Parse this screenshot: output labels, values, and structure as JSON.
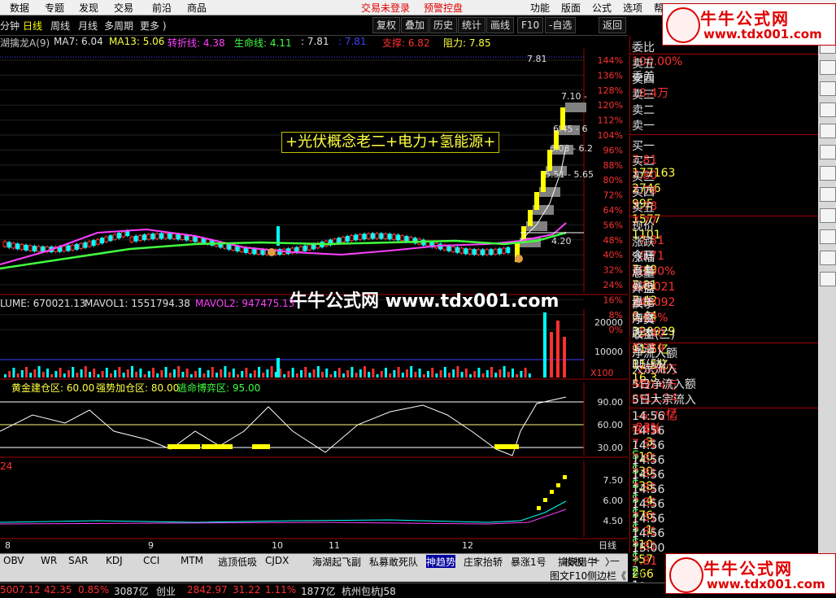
{
  "menu": {
    "items": [
      "数据",
      "专题",
      "发现",
      "交易",
      "前沿",
      "商品"
    ],
    "trade_login": "交易未登录",
    "warning": "预警控盘",
    "right_items": [
      "功能",
      "版面",
      "公式",
      "选项",
      "帮"
    ]
  },
  "toolbar": {
    "periods": [
      "分钟",
      "日线",
      "周线",
      "月线",
      "多周期",
      "更多 )"
    ],
    "selected": "日线",
    "buttons": [
      "复权",
      "叠加",
      "历史",
      "统计",
      "画线",
      "F10",
      "-自选",
      "返回"
    ]
  },
  "price_legend": {
    "name": "湖擒龙A(9)",
    "ma7": "MA7: 6.04",
    "ma13": "MA13: 5.06",
    "turn": "转折线: 4.38",
    "life": "生命线: 4.11",
    "val": ": 7.81",
    "val2": ": 7.81",
    "support": "支撑: 6.82",
    "resist": "阻力: 7.85"
  },
  "annotation": "+光伏概念老二+电力+氢能源+",
  "price_labels": {
    "top": "7.81",
    "a": "7.10 -",
    "b": "6.45 - 6",
    "c": "6.03 - 6.2",
    "d": "5.51 - 5.65",
    "low": "4.20"
  },
  "pct_axis": [
    "144%",
    "136%",
    "128%",
    "120%",
    "112%",
    "104%",
    "96%",
    "88%",
    "80%",
    "72%",
    "64%",
    "56%",
    "48%",
    "40%",
    "32%",
    "24%",
    "16%",
    "8%",
    "0%"
  ],
  "watermark": "牛牛公式网 www.tdx001.com",
  "vol_legend": {
    "vol": "LUME: 670021.13",
    "mavol1": "MAVOL1: 1551794.38",
    "mavol2": "MAVOL2: 947475.13"
  },
  "vol_axis": [
    "20000",
    "10000"
  ],
  "vol_unit": "X100",
  "kdj_legend": {
    "a": "黄金建仓区: 60.00",
    "b": "强势加仓区: 80.00",
    "c": "逃命博弈区: 95.00"
  },
  "kdj_axis": [
    "90.00",
    "60.00",
    "30.00"
  ],
  "last_legend": "24",
  "last_axis": [
    "7.50",
    "6.00",
    "4.50"
  ],
  "date_axis": [
    "8",
    "9",
    "10",
    "11",
    "12"
  ],
  "period_label": "日线",
  "quote": {
    "weibi": {
      "label": "委比",
      "value": "100.00%",
      "label2": "委差",
      "value2": "18.4万"
    },
    "sell": [
      {
        "label": "卖五"
      },
      {
        "label": "卖四"
      },
      {
        "label": "卖三"
      },
      {
        "label": "卖二"
      },
      {
        "label": "卖一"
      }
    ],
    "buy": [
      {
        "label": "买一",
        "price": "7.81",
        "vol": "177163"
      },
      {
        "label": "买二",
        "price": "7.80",
        "vol": "2746"
      },
      {
        "label": "买三",
        "price": "7.79",
        "vol": "995"
      },
      {
        "label": "买四",
        "price": "7.78",
        "vol": "1577"
      },
      {
        "label": "买五",
        "price": "7.77",
        "vol": "1101"
      }
    ],
    "stats": [
      {
        "l1": "现价",
        "v1": "7.81",
        "l2": "今开",
        "v2": "7.49"
      },
      {
        "l1": "涨跌",
        "v1": "0.71",
        "l2": "最高",
        "v2": "7.81"
      },
      {
        "l1": "涨幅",
        "v1": "10.00%",
        "l2": "最低",
        "v2": "7.42"
      },
      {
        "l1": "总量",
        "v1": "670021",
        "l2": "量比",
        "v2": "0.44"
      },
      {
        "l1": "外盘",
        "v1": "349092",
        "l2": "内盘",
        "v2": "320929"
      },
      {
        "l1": "换手",
        "v1": "5.82%",
        "l2": "股本",
        "v2": "11.5亿"
      },
      {
        "l1": "净资",
        "v1": "5.40",
        "l2": "流通",
        "v2": "11.5亿"
      },
      {
        "l1": "收益(三)",
        "v1": "0.359",
        "l2": "PE(动)",
        "v2": "16.3"
      }
    ],
    "flows": [
      {
        "l": "净流入额",
        "v": "2036万",
        "p": "4%"
      },
      {
        "l": "大宗流入",
        "v": "4204万",
        "p": "8%"
      },
      {
        "l": "5日净流入额",
        "v": "-11.24亿",
        "p": "-23%"
      },
      {
        "l": "5日大宗流入",
        "v": "-6.72亿",
        "p": "-14%"
      }
    ],
    "ticks": [
      {
        "t": "14:56",
        "p": "7.81",
        "v": "3",
        "s": "S",
        "n": "1"
      },
      {
        "t": "14:56",
        "p": "7.81",
        "v": "10",
        "s": "S",
        "n": "1"
      },
      {
        "t": "14:56",
        "p": "7.81",
        "v": "30",
        "s": "S",
        "n": "1"
      },
      {
        "t": "14:56",
        "p": "7.81",
        "v": "38",
        "s": "S",
        "n": "1"
      },
      {
        "t": "14:56",
        "p": "7.81",
        "v": "4",
        "s": "S",
        "n": "1"
      },
      {
        "t": "14:56",
        "p": "7.81",
        "v": "76",
        "s": "S",
        "n": "1"
      },
      {
        "t": "14:56",
        "p": "7.81",
        "v": "1",
        "s": "S",
        "n": "1"
      },
      {
        "t": "14:56",
        "p": "7.81",
        "v": "10",
        "s": "S",
        "n": "2"
      },
      {
        "t": "14:56",
        "p": "7.81",
        "v": "57",
        "s": "S",
        "n": "1"
      },
      {
        "t": "15:00",
        "p": "7.81",
        "v": "266",
        "s": "",
        "n": "12"
      }
    ]
  },
  "bottom_tabs": [
    "OBV",
    "WR",
    "SAR",
    "KDJ",
    "CCI",
    "MTM",
    "逃顶低吸",
    "CJDX",
    "海湖起飞副",
    "私募敢死队",
    "神趋势",
    "庄家抬轿",
    "暴涨1号",
    "擒妖猎牛",
    "〉",
    "模板",
    "+",
    "—"
  ],
  "bottom2": [
    "图文F10",
    "侧边栏《",
    "笔",
    "价"
  ],
  "status": {
    "a": "5007.12",
    "b": "42.35",
    "c": "0.85%",
    "d": "3087亿",
    "e": "创业",
    "f": "2842.97",
    "g": "31.22",
    "h": "1.11%",
    "i": "1877亿",
    "j": "杭州包杭J58"
  },
  "logo": {
    "title": "牛牛公式网",
    "url": "www.tdx001.com"
  },
  "colors": {
    "up": "#ff3030",
    "down": "#00ffff",
    "ma_purple": "#ff40ff",
    "ma_green": "#40ff40",
    "yellow": "#ffff00"
  }
}
